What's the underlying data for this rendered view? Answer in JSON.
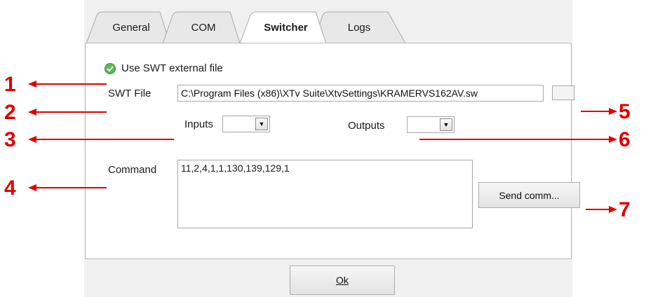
{
  "tabs": [
    {
      "label": "General",
      "active": false
    },
    {
      "label": "COM",
      "active": false
    },
    {
      "label": "Switcher",
      "active": true
    },
    {
      "label": "Logs",
      "active": false
    }
  ],
  "switcher": {
    "use_external_label": "Use SWT external file",
    "use_external_checked": true,
    "swt_file_label": "SWT File",
    "swt_file_value": "C:\\Program Files (x86)\\XTv Suite\\XtvSettings\\KRAMERVS162AV.sw",
    "inputs_label": "Inputs",
    "inputs_value": "",
    "outputs_label": "Outputs",
    "outputs_value": "",
    "command_label": "Command",
    "command_value": "11,2,4,1,1,130,139,129,1",
    "send_button": "Send comm..."
  },
  "footer": {
    "ok_button": "Ok"
  },
  "annotations": [
    "1",
    "2",
    "3",
    "4",
    "5",
    "6",
    "7"
  ],
  "colors": {
    "annotation": "#e00000",
    "check": "#4caf50",
    "panel_border": "#b9b9b9"
  }
}
